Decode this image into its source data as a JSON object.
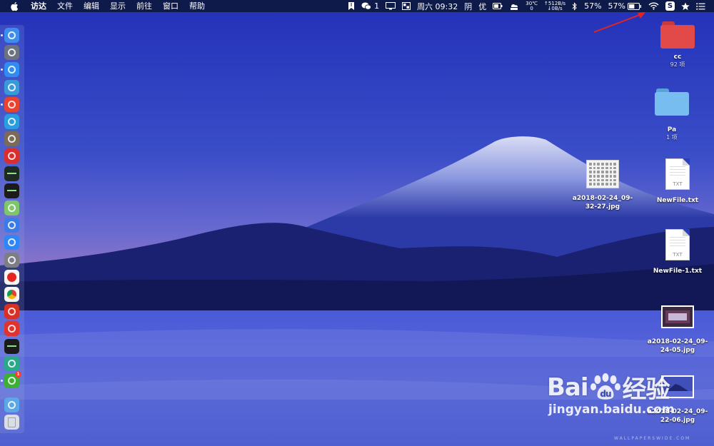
{
  "menubar": {
    "items": [
      "访达",
      "文件",
      "编辑",
      "显示",
      "前往",
      "窗口",
      "帮助"
    ],
    "status": {
      "wechat_count": "1",
      "datetime": "周六 09:32",
      "weather": "阴",
      "air_quality": "优",
      "temperature": "30℃",
      "temp_sub": "0",
      "net_up": "↑512B/s",
      "net_down": "↓0B/s",
      "battery_percent_1": "57%",
      "battery_percent_2": "57%",
      "battery_level": 0.57,
      "s_badge": "S"
    }
  },
  "dock": {
    "apps": [
      {
        "icon": "finder-icon",
        "color": "#3d8cf0"
      },
      {
        "icon": "launchpad-icon",
        "color": "#6b7280"
      },
      {
        "icon": "safari-icon",
        "color": "#2f8cf2"
      },
      {
        "icon": "search-app-icon",
        "color": "#3a9ad9"
      },
      {
        "icon": "youdao-icon",
        "color": "#e8432e"
      },
      {
        "icon": "transfer-icon",
        "color": "#2b9ce0"
      },
      {
        "icon": "photo-app-icon",
        "color": "#7a6a58"
      },
      {
        "icon": "media-app-icon",
        "color": "#d82e2e"
      },
      {
        "icon": "activity-monitor-icon",
        "color": "#1e2a22"
      },
      {
        "icon": "terminal-icon",
        "color": "#1b1b1b"
      },
      {
        "icon": "maps-icon",
        "color": "#7ec66a"
      },
      {
        "icon": "siri-icon",
        "color": "#3b7be8"
      },
      {
        "icon": "app-store-icon",
        "color": "#2f86f5"
      },
      {
        "icon": "system-preferences-icon",
        "color": "#7d7d86"
      },
      {
        "icon": "yandex-browser-icon",
        "color": "#f5f5f5"
      },
      {
        "icon": "chrome-icon",
        "color": "#f5f5f5"
      },
      {
        "icon": "netease-music-icon",
        "color": "#d93025"
      },
      {
        "icon": "vivaldi-icon",
        "color": "#e0332e"
      },
      {
        "icon": "shell-icon",
        "color": "#1b1b1b"
      },
      {
        "icon": "browser-icon",
        "color": "#2aa88a"
      },
      {
        "icon": "wechat-icon",
        "color": "#3cb034",
        "badge": "1"
      },
      {
        "icon": "downloads-folder-icon",
        "color": "#5aa8e8"
      },
      {
        "icon": "trash-icon",
        "color": "#d9dde6"
      }
    ]
  },
  "desktop": {
    "items": [
      {
        "name": "cc",
        "sub": "92 项",
        "kind": "folder",
        "color": "#e24a4a"
      },
      {
        "name": "Pa",
        "sub": "1 项",
        "kind": "folder",
        "color": "#6bb6ee"
      },
      {
        "name": "a2018-02-24_09-32-27.jpg",
        "line1": "a2018-02-24_09-",
        "line2": "32-27.jpg",
        "kind": "screenshot"
      },
      {
        "name": "NewFile.txt",
        "kind": "txt",
        "ext": "TXT"
      },
      {
        "name": "NewFile-1.txt",
        "kind": "txt",
        "ext": "TXT"
      },
      {
        "name": "a2018-02-24_09-24-05.jpg",
        "line1": "a2018-02-24_09-",
        "line2": "24-05.jpg",
        "kind": "photo"
      },
      {
        "name": "a2018-02-24_09-22-06.jpg",
        "line1": "a2018-02-24_09-",
        "line2": "22-06.jpg",
        "kind": "photo"
      }
    ]
  },
  "watermark": {
    "brand_latin": "Bai",
    "brand_suffix": "du",
    "brand_cn": "经验",
    "url": "jingyan.baidu.com",
    "wallpaper_credit": "WALLPAPERSWIDE.COM"
  }
}
